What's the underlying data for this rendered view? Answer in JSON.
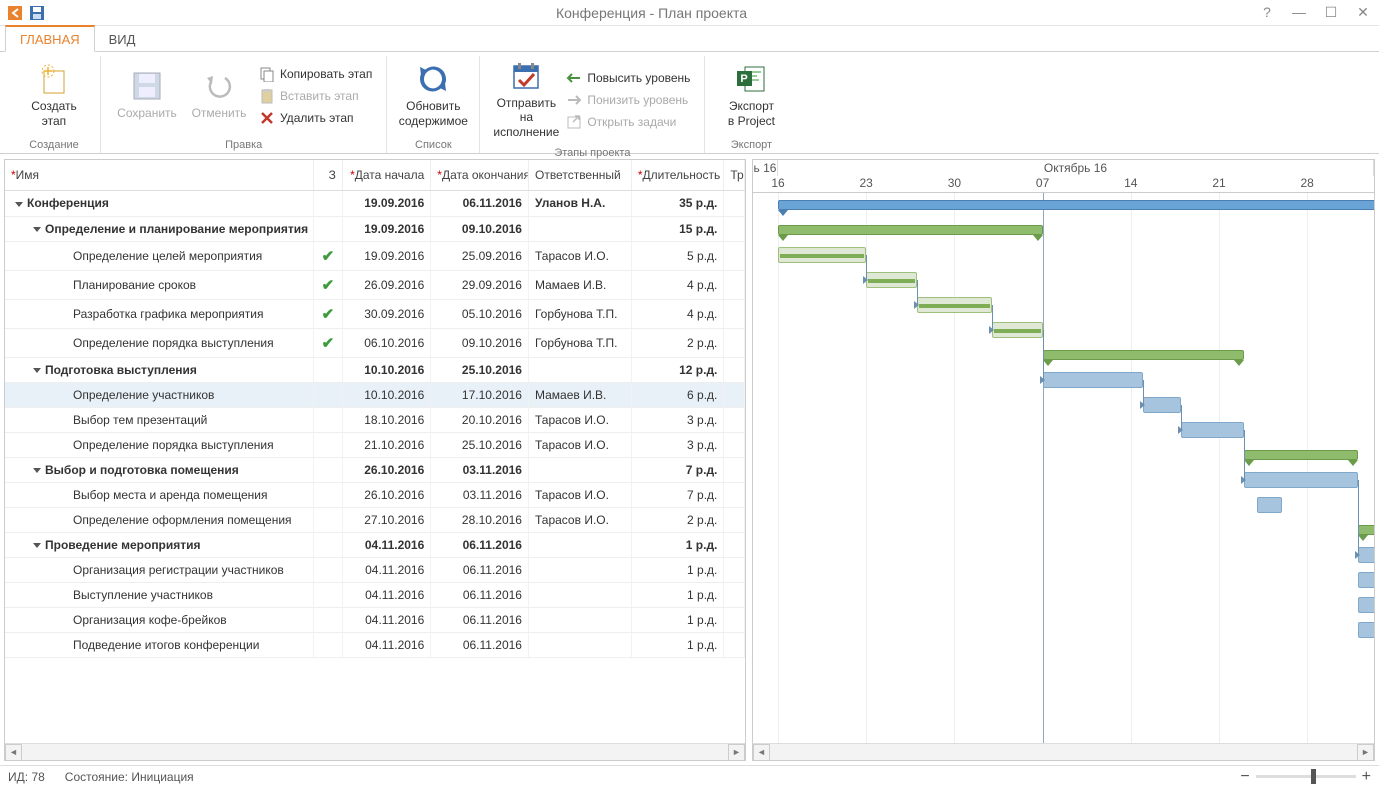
{
  "title": "Конференция - План проекта",
  "tabs": {
    "main": "ГЛАВНАЯ",
    "view": "ВИД"
  },
  "ribbon": {
    "create": {
      "label": "Создать\nэтап",
      "group": "Создание"
    },
    "save": {
      "label": "Сохранить"
    },
    "undo": {
      "label": "Отменить"
    },
    "copy": {
      "label": "Копировать этап"
    },
    "paste": {
      "label": "Вставить этап"
    },
    "delete": {
      "label": "Удалить этап"
    },
    "edit_group": "Правка",
    "refresh": {
      "label": "Обновить\nсодержимое",
      "group": "Список"
    },
    "send": {
      "label": "Отправить на\nисполнение"
    },
    "promote": {
      "label": "Повысить уровень"
    },
    "demote": {
      "label": "Понизить уровень"
    },
    "open_tasks": {
      "label": "Открыть задачи"
    },
    "stages_group": "Этапы проекта",
    "export": {
      "label": "Экспорт\nв Project",
      "group": "Экспорт"
    }
  },
  "columns": {
    "name": "Имя",
    "status": "З",
    "start": "Дата начала",
    "end": "Дата окончания",
    "resp": "Ответственный",
    "dur": "Длительность",
    "extra": "Тр"
  },
  "gantt_header": {
    "month1": "ь 16",
    "month2": "Октябрь 16",
    "weeks": [
      "16",
      "23",
      "30",
      "07",
      "14",
      "21",
      "28"
    ]
  },
  "rows": [
    {
      "lvl": 0,
      "bold": true,
      "exp": true,
      "name": "Конференция",
      "chk": "",
      "start": "19.09.2016",
      "end": "06.11.2016",
      "resp": "Уланов Н.А.",
      "dur": "35 р.д.",
      "type": "root",
      "gs": 0,
      "gw": 49
    },
    {
      "lvl": 1,
      "bold": true,
      "exp": true,
      "name": "Определение и планирование мероприятия",
      "chk": "",
      "start": "19.09.2016",
      "end": "09.10.2016",
      "resp": "",
      "dur": "15 р.д.",
      "type": "summary",
      "gs": 0,
      "gw": 21
    },
    {
      "lvl": 2,
      "bold": false,
      "name": "Определение целей мероприятия",
      "chk": "✓",
      "start": "19.09.2016",
      "end": "25.09.2016",
      "resp": "Тарасов И.О.",
      "dur": "5 р.д.",
      "type": "done",
      "gs": 0,
      "gw": 7
    },
    {
      "lvl": 2,
      "bold": false,
      "name": "Планирование сроков",
      "chk": "✓",
      "start": "26.09.2016",
      "end": "29.09.2016",
      "resp": "Мамаев И.В.",
      "dur": "4 р.д.",
      "type": "done",
      "gs": 7,
      "gw": 4
    },
    {
      "lvl": 2,
      "bold": false,
      "name": "Разработка графика мероприятия",
      "chk": "✓",
      "start": "30.09.2016",
      "end": "05.10.2016",
      "resp": "Горбунова Т.П.",
      "dur": "4 р.д.",
      "type": "done",
      "gs": 11,
      "gw": 6
    },
    {
      "lvl": 2,
      "bold": false,
      "name": "Определение порядка выступления",
      "chk": "✓",
      "start": "06.10.2016",
      "end": "09.10.2016",
      "resp": "Горбунова Т.П.",
      "dur": "2 р.д.",
      "type": "done",
      "gs": 17,
      "gw": 4
    },
    {
      "lvl": 1,
      "bold": true,
      "exp": true,
      "name": "Подготовка выступления",
      "chk": "",
      "start": "10.10.2016",
      "end": "25.10.2016",
      "resp": "",
      "dur": "12 р.д.",
      "type": "summary",
      "gs": 21,
      "gw": 16
    },
    {
      "lvl": 2,
      "bold": false,
      "sel": true,
      "name": "Определение участников",
      "chk": "",
      "start": "10.10.2016",
      "end": "17.10.2016",
      "resp": "Мамаев И.В.",
      "dur": "6 р.д.",
      "type": "task",
      "gs": 21,
      "gw": 8
    },
    {
      "lvl": 2,
      "bold": false,
      "name": "Выбор тем презентаций",
      "chk": "",
      "start": "18.10.2016",
      "end": "20.10.2016",
      "resp": "Тарасов И.О.",
      "dur": "3 р.д.",
      "type": "task",
      "gs": 29,
      "gw": 3
    },
    {
      "lvl": 2,
      "bold": false,
      "name": "Определение порядка выступления",
      "chk": "",
      "start": "21.10.2016",
      "end": "25.10.2016",
      "resp": "Тарасов И.О.",
      "dur": "3 р.д.",
      "type": "task",
      "gs": 32,
      "gw": 5
    },
    {
      "lvl": 1,
      "bold": true,
      "exp": true,
      "name": "Выбор и подготовка помещения",
      "chk": "",
      "start": "26.10.2016",
      "end": "03.11.2016",
      "resp": "",
      "dur": "7 р.д.",
      "type": "summary",
      "gs": 37,
      "gw": 9
    },
    {
      "lvl": 2,
      "bold": false,
      "name": "Выбор места и аренда помещения",
      "chk": "",
      "start": "26.10.2016",
      "end": "03.11.2016",
      "resp": "Тарасов И.О.",
      "dur": "7 р.д.",
      "type": "task",
      "gs": 37,
      "gw": 9
    },
    {
      "lvl": 2,
      "bold": false,
      "name": "Определение оформления помещения",
      "chk": "",
      "start": "27.10.2016",
      "end": "28.10.2016",
      "resp": "Тарасов И.О.",
      "dur": "2 р.д.",
      "type": "task",
      "gs": 38,
      "gw": 2
    },
    {
      "lvl": 1,
      "bold": true,
      "exp": true,
      "name": "Проведение мероприятия",
      "chk": "",
      "start": "04.11.2016",
      "end": "06.11.2016",
      "resp": "",
      "dur": "1 р.д.",
      "type": "summary",
      "gs": 46,
      "gw": 3
    },
    {
      "lvl": 2,
      "bold": false,
      "name": "Организация регистрации участников",
      "chk": "",
      "start": "04.11.2016",
      "end": "06.11.2016",
      "resp": "",
      "dur": "1 р.д.",
      "type": "task",
      "gs": 46,
      "gw": 3
    },
    {
      "lvl": 2,
      "bold": false,
      "name": "Выступление участников",
      "chk": "",
      "start": "04.11.2016",
      "end": "06.11.2016",
      "resp": "",
      "dur": "1 р.д.",
      "type": "task",
      "gs": 46,
      "gw": 3
    },
    {
      "lvl": 2,
      "bold": false,
      "name": "Организация кофе-брейков",
      "chk": "",
      "start": "04.11.2016",
      "end": "06.11.2016",
      "resp": "",
      "dur": "1 р.д.",
      "type": "task",
      "gs": 46,
      "gw": 3
    },
    {
      "lvl": 2,
      "bold": false,
      "name": "Подведение итогов конференции",
      "chk": "",
      "start": "04.11.2016",
      "end": "06.11.2016",
      "resp": "",
      "dur": "1 р.д.",
      "type": "task",
      "gs": 46,
      "gw": 3
    }
  ],
  "status": {
    "id_label": "ИД:",
    "id_val": "78",
    "state_label": "Состояние:",
    "state_val": "Инициация"
  }
}
